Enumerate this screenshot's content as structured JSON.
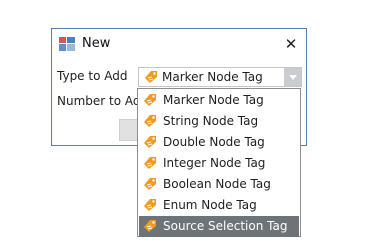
{
  "dialog": {
    "title": "New",
    "close_glyph": "✕",
    "type_label": "Type to Add",
    "number_label": "Number to Add",
    "selected_type": "Marker Node Tag"
  },
  "dropdown": {
    "items": [
      {
        "label": "Marker Node Tag"
      },
      {
        "label": "String Node Tag"
      },
      {
        "label": "Double Node Tag"
      },
      {
        "label": "Integer Node Tag"
      },
      {
        "label": "Boolean Node Tag"
      },
      {
        "label": "Enum Node Tag"
      },
      {
        "label": "Source Selection Tag"
      }
    ],
    "highlighted_item": "Source Selection Tag"
  },
  "colors": {
    "tag_icon": "#f39a1e",
    "highlight": "#6e7378",
    "window_border": "#5a7fa8"
  },
  "icons": {
    "app": "app-logo-icon",
    "close": "close-icon",
    "tag": "tag-icon",
    "dropdown_arrow": "chevron-down-icon"
  }
}
